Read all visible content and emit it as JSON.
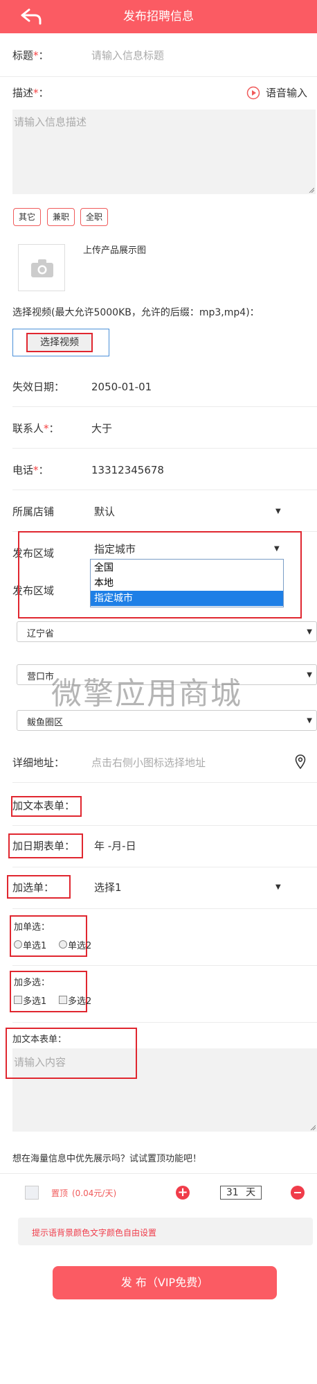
{
  "header": {
    "title": "发布招聘信息"
  },
  "form": {
    "title_label": "标题",
    "required_mark": "*",
    "colon": "：",
    "title_placeholder": "请输入信息标题",
    "desc_label": "描述",
    "voice_input": "语音输入",
    "desc_placeholder": "请输入信息描述",
    "tags": [
      "其它",
      "兼职",
      "全职"
    ],
    "upload_label": "上传产品展示图",
    "video_hint": "选择视频(最大允许5000KB，允许的后缀：mp3,mp4)：",
    "video_button": "选择视频",
    "expire_label": "失效日期：",
    "expire_value": "2050-01-01",
    "contact_label": "联系人",
    "contact_value": "大于",
    "phone_label": "电话",
    "phone_value": "13312345678",
    "shop_label": "所属店铺",
    "shop_value": "默认",
    "region_label": "发布区域",
    "region_value": "指定城市",
    "region_options": [
      "全国",
      "本地",
      "指定城市"
    ],
    "region_label2": "发布区域",
    "province": "辽宁省",
    "city": "营口市",
    "district": "鲅鱼圈区",
    "watermark": "微擎应用商城",
    "address_label": "详细地址：",
    "address_placeholder": "点击右侧小图标选择地址",
    "text_form_label": "加文本表单：",
    "date_form_label": "加日期表单：",
    "date_value": "年 -月-日",
    "select_form_label": "加选单：",
    "select_value": "选择1",
    "radio_label": "加单选：",
    "radio_options": [
      "单选1",
      "单选2"
    ],
    "checkbox_label": "加多选：",
    "checkbox_options": [
      "多选1",
      "多选2"
    ],
    "textarea_label": "加文本表单：",
    "textarea_placeholder": "请输入内容",
    "top_question": "想在海量信息中优先展示吗？试试置顶功能吧！",
    "top_label": "置顶",
    "top_price": "(0.04元/天)",
    "top_days": "31",
    "top_unit": "天",
    "notice": "提示语背景颜色文字颜色自由设置",
    "submit": "发 布（VIP免费）"
  },
  "colors": {
    "brand": "#fb5b63",
    "required": "#f54141",
    "highlight": "#e0262f"
  }
}
